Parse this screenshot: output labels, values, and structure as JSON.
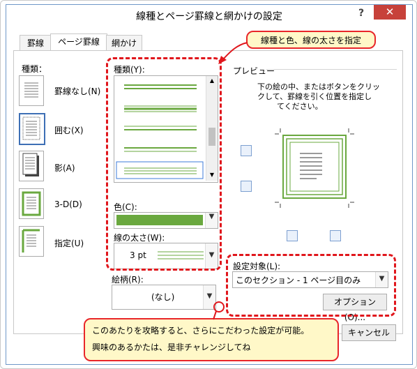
{
  "window": {
    "title": "線種とページ罫線と網かけの設定",
    "help": "?",
    "close": "✕"
  },
  "tabs": [
    {
      "label": "罫線"
    },
    {
      "label": "ページ罫線"
    },
    {
      "label": "網かけ"
    }
  ],
  "setting": {
    "heading": "種類：",
    "items": [
      {
        "label": "罫線なし(N)"
      },
      {
        "label": "囲む(X)"
      },
      {
        "label": "影(A)"
      },
      {
        "label": "3-D(D)"
      },
      {
        "label": "指定(U)"
      }
    ]
  },
  "style": {
    "label": "種類(Y):"
  },
  "color": {
    "label": "色(C):",
    "value": "#6aa83f"
  },
  "width": {
    "label": "線の太さ(W):",
    "value": "3 pt"
  },
  "art": {
    "label": "絵柄(R):",
    "value": "(なし)"
  },
  "preview": {
    "heading": "プレビュー",
    "instructions": [
      "下の絵の中、またはボタンをクリッ",
      "クして、罫線を引く位置を指定し",
      "てください。"
    ]
  },
  "apply": {
    "label": "設定対象(L):",
    "value": "このセクション - 1 ページ目のみ"
  },
  "buttons": {
    "options": "オプション(O)...",
    "cancel": "キャンセル"
  },
  "callout_top": "線種と色、線の太さを指定",
  "callout_bottom": [
    "このあたりを攻略すると、さらにこだわった設定が可能。",
    "興味のあるかたは、是非チャレンジしてね"
  ],
  "colors": {
    "accent": "#6aa83f",
    "dash": "#e0161c",
    "callout_bg": "#fff8c8"
  }
}
